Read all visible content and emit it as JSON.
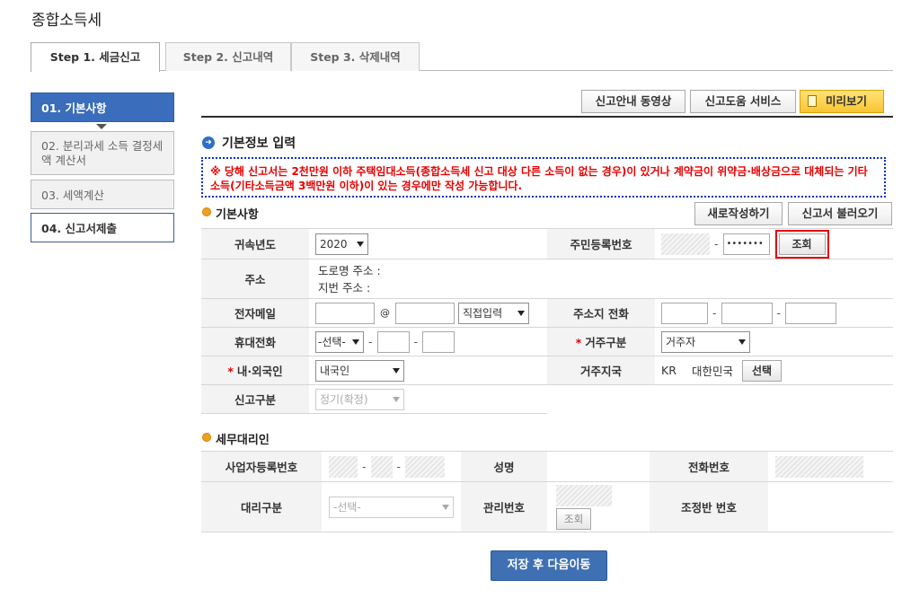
{
  "page_title": "종합소득세",
  "tabs": [
    "Step 1. 세금신고",
    "Step 2. 신고내역",
    "Step 3. 삭제내역"
  ],
  "sidebar": [
    "01. 기본사항",
    "02. 분리과세 소득 결정세액 계산서",
    "03. 세액계산",
    "04. 신고서제출"
  ],
  "toolbar": {
    "video": "신고안내 동영상",
    "help": "신고도움 서비스",
    "preview": "미리보기"
  },
  "section_title": "기본정보 입력",
  "notice": "※ 당해 신고서는 2천만원 이하 주택임대소득(종합소득세 신고 대상 다른 소득이 없는 경우)이 있거나 계약금이 위약금·배상금으로 대체되는 기타소득(기타소득금액 3백만원 이하)이 있는 경우에만 작성 가능합니다.",
  "basic": {
    "title": "기본사항",
    "new_btn": "새로작성하기",
    "load_btn": "신고서 불러오기",
    "year_label": "귀속년도",
    "year_value": "2020",
    "rrn_label": "주민등록번호",
    "rrn_mask": "•••••••",
    "lookup_btn": "조회",
    "addr_label": "주소",
    "road_addr": "도로명 주소 :",
    "lot_addr": "지번 주소 :",
    "email_label": "전자메일",
    "email_at": "@",
    "email_domain": "직접입력",
    "home_phone_label": "주소지 전화",
    "mobile_label": "휴대전화",
    "mobile_select": "-선택-",
    "residence_label": "거주구분",
    "residence_value": "거주자",
    "nationality_label": "내·외국인",
    "nationality_value": "내국인",
    "region_label": "거주지국",
    "region_code": "KR",
    "region_name": "대한민국",
    "region_btn": "선택",
    "report_type_label": "신고구분",
    "report_type_value": "정기(확정)"
  },
  "agent": {
    "title": "세무대리인",
    "biz_no_label": "사업자등록번호",
    "name_label": "성명",
    "phone_label": "전화번호",
    "type_label": "대리구분",
    "type_select": "-선택-",
    "mgmt_label": "관리번호",
    "mgmt_btn": "조회",
    "team_label": "조정반 번호"
  },
  "save_btn": "저장 후 다음이동",
  "colors": {
    "primary": "#3a6dbb",
    "notice": "#e60000",
    "highlight": "#e00000",
    "preview_bg": "#ffd54a"
  }
}
